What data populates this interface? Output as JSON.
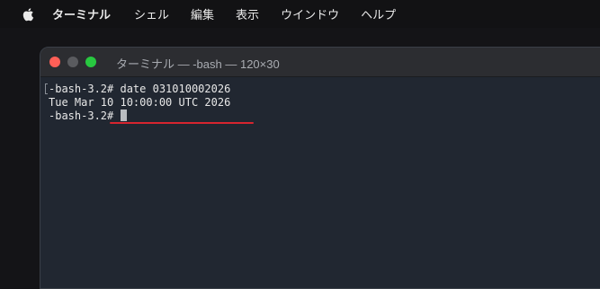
{
  "menubar": {
    "apple_icon": "apple-logo-icon",
    "app_name": "ターミナル",
    "items": [
      "シェル",
      "編集",
      "表示",
      "ウインドウ",
      "ヘルプ"
    ]
  },
  "window": {
    "title": "ターミナル — -bash — 120×30",
    "controls": {
      "close_color": "#ff5f57",
      "minimize_color": "#5a5b5f",
      "zoom_color": "#28c840"
    }
  },
  "terminal": {
    "prompt": "-bash-3.2#",
    "command": "date 031010002026",
    "output": "Tue Mar 10 10:00:00 UTC 2026",
    "prompt2": "-bash-3.2#",
    "annotation_color": "#d7252f"
  }
}
